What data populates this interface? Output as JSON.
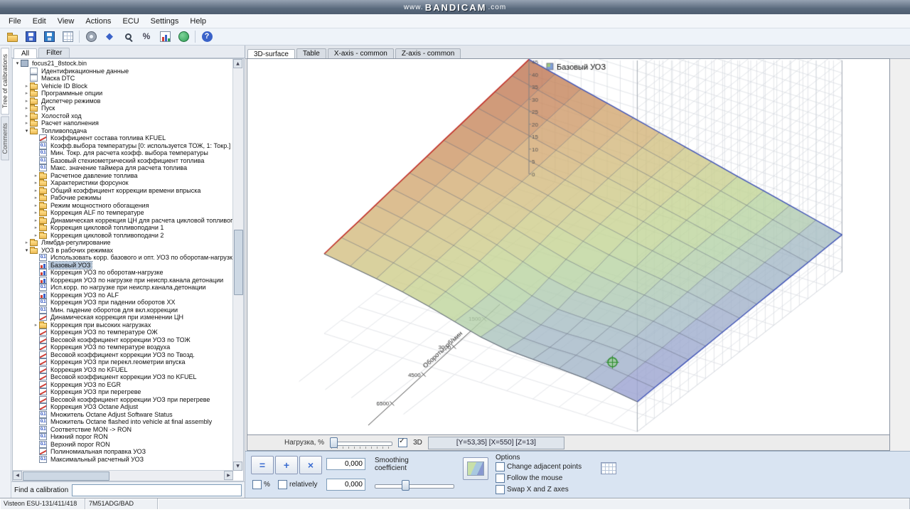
{
  "watermark": {
    "prefix": "www.",
    "brand": "BANDICAM",
    "suffix": ".com"
  },
  "menu": {
    "items": [
      "File",
      "Edit",
      "View",
      "Actions",
      "ECU",
      "Settings",
      "Help"
    ]
  },
  "toolbar": {
    "icons": [
      "open",
      "save",
      "save2",
      "table",
      "sep",
      "gear",
      "compare",
      "zoom",
      "percent",
      "chart",
      "globe",
      "sep",
      "help"
    ]
  },
  "sidebar": {
    "vertical_tabs": [
      "Tree of calibrations",
      "Comments"
    ],
    "tabs": [
      "All",
      "Filter"
    ],
    "find_label": "Find a calibration",
    "find_value": "",
    "items": [
      {
        "label": "focus21_8stock.bin",
        "indent": 0,
        "icon": "bin",
        "expand": "open"
      },
      {
        "label": "Идентификационные данные",
        "indent": 1,
        "icon": "page"
      },
      {
        "label": "Маска DTC",
        "indent": 1,
        "icon": "page"
      },
      {
        "label": "Vehicle ID Block",
        "indent": 1,
        "icon": "folder",
        "expand": "closed"
      },
      {
        "label": "Программные опции",
        "indent": 1,
        "icon": "folder",
        "expand": "closed"
      },
      {
        "label": "Диспетчер режимов",
        "indent": 1,
        "icon": "folder",
        "expand": "closed"
      },
      {
        "label": "Пуск",
        "indent": 1,
        "icon": "folder",
        "expand": "closed"
      },
      {
        "label": "Холостой ход",
        "indent": 1,
        "icon": "folder",
        "expand": "closed"
      },
      {
        "label": "Расчет наполнения",
        "indent": 1,
        "icon": "folder",
        "expand": "closed"
      },
      {
        "label": "Топливоподача",
        "indent": 1,
        "icon": "folder",
        "expand": "open"
      },
      {
        "label": "Коэффициент состава топлива KFUEL",
        "indent": 2,
        "icon": "curve"
      },
      {
        "label": "Коэфф.выбора температуры [0: используется ТОЖ, 1: Токр.]",
        "indent": 2,
        "icon": "num"
      },
      {
        "label": "Мин. Токр. для расчета коэфф. выбора температуры",
        "indent": 2,
        "icon": "num"
      },
      {
        "label": "Базовый стехиометрический коэффициент топлива",
        "indent": 2,
        "icon": "num"
      },
      {
        "label": "Макс. значение таймера для расчета топлива",
        "indent": 2,
        "icon": "num"
      },
      {
        "label": "Расчетное давление топлива",
        "indent": 2,
        "icon": "folder",
        "expand": "closed"
      },
      {
        "label": "Характеристики форсунок",
        "indent": 2,
        "icon": "folder",
        "expand": "closed"
      },
      {
        "label": "Общий коэффициент коррекции времени впрыска",
        "indent": 2,
        "icon": "folder",
        "expand": "closed"
      },
      {
        "label": "Рабочие режимы",
        "indent": 2,
        "icon": "folder",
        "expand": "closed"
      },
      {
        "label": "Режим мощностного обогащения",
        "indent": 2,
        "icon": "folder",
        "expand": "closed"
      },
      {
        "label": "Коррекция ALF по температуре",
        "indent": 2,
        "icon": "folder",
        "expand": "closed"
      },
      {
        "label": "Динамическая коррекция ЦН для расчета цикловой топливоподачи",
        "indent": 2,
        "icon": "folder",
        "expand": "closed"
      },
      {
        "label": "Коррекция цикловой топливоподачи 1",
        "indent": 2,
        "icon": "folder",
        "expand": "closed"
      },
      {
        "label": "Коррекция цикловой топливоподачи 2",
        "indent": 2,
        "icon": "folder",
        "expand": "closed"
      },
      {
        "label": "Лямбда-регулирование",
        "indent": 1,
        "icon": "folder",
        "expand": "closed"
      },
      {
        "label": "УОЗ в рабочих режимах",
        "indent": 1,
        "icon": "folder",
        "expand": "open"
      },
      {
        "label": "Использовать корр. базового и опт. УОЗ по оборотам-нагрузке",
        "indent": 2,
        "icon": "num"
      },
      {
        "label": "Базовый УОЗ",
        "indent": 2,
        "icon": "chart",
        "selected": true
      },
      {
        "label": "Коррекция УОЗ по оборотам-нагрузке",
        "indent": 2,
        "icon": "chart"
      },
      {
        "label": "Коррекция УОЗ по нагрузке при неиспр.канала детонации",
        "indent": 2,
        "icon": "chart"
      },
      {
        "label": "Исп.корр. по нагрузке при неиспр.канала.детонации",
        "indent": 2,
        "icon": "num"
      },
      {
        "label": "Коррекция УОЗ по ALF",
        "indent": 2,
        "icon": "chart"
      },
      {
        "label": "Коррекция УОЗ при падении оборотов XX",
        "indent": 2,
        "icon": "num"
      },
      {
        "label": "Мин. падение оборотов для вкл.коррекции",
        "indent": 2,
        "icon": "num"
      },
      {
        "label": "Динамическая коррекция при изменении ЦН",
        "indent": 2,
        "icon": "curve"
      },
      {
        "label": "Коррекция при высоких нагрузках",
        "indent": 2,
        "icon": "folder",
        "expand": "closed"
      },
      {
        "label": "Коррекция УОЗ по температуре ОЖ",
        "indent": 2,
        "icon": "curve"
      },
      {
        "label": "Весовой коэффициент коррекции УОЗ по ТОЖ",
        "indent": 2,
        "icon": "curve"
      },
      {
        "label": "Коррекция УОЗ по температуре воздуха",
        "indent": 2,
        "icon": "curve"
      },
      {
        "label": "Весовой коэффициент коррекции УОЗ по Твозд.",
        "indent": 2,
        "icon": "curve"
      },
      {
        "label": "Коррекция УОЗ при перекл.геометрии впуска",
        "indent": 2,
        "icon": "curve"
      },
      {
        "label": "Коррекция УОЗ по KFUEL",
        "indent": 2,
        "icon": "curve"
      },
      {
        "label": "Весовой коэффициент коррекции УОЗ по KFUEL",
        "indent": 2,
        "icon": "curve"
      },
      {
        "label": "Коррекция УОЗ по EGR",
        "indent": 2,
        "icon": "curve"
      },
      {
        "label": "Коррекция УОЗ при перегреве",
        "indent": 2,
        "icon": "curve"
      },
      {
        "label": "Весовой коэффициент коррекции УОЗ при перегреве",
        "indent": 2,
        "icon": "curve"
      },
      {
        "label": "Коррекция УОЗ Octane Adjust",
        "indent": 2,
        "icon": "curve"
      },
      {
        "label": "Множитель Octane Adjust Software Status",
        "indent": 2,
        "icon": "num"
      },
      {
        "label": "Множитель Octane flashed into vehicle at final assembly",
        "indent": 2,
        "icon": "num"
      },
      {
        "label": "Соответствие MON -> RON",
        "indent": 2,
        "icon": "num"
      },
      {
        "label": "Нижний порог RON",
        "indent": 2,
        "icon": "num"
      },
      {
        "label": "Верхний порог RON",
        "indent": 2,
        "icon": "num"
      },
      {
        "label": "Полиномиальная поправка УОЗ",
        "indent": 2,
        "icon": "curve"
      },
      {
        "label": "Максимальный расчетный УОЗ",
        "indent": 2,
        "icon": "num"
      }
    ]
  },
  "main": {
    "tabs": [
      {
        "label": "3D-surface",
        "active": true
      },
      {
        "label": "Table",
        "active": false
      },
      {
        "label": "X-axis - common",
        "active": false
      },
      {
        "label": "Z-axis - common",
        "active": false
      }
    ],
    "slider_label": "Нагрузка, %",
    "checkbox_3d": "3D",
    "readout": "[Y=53,35] [X=550] [Z=13]"
  },
  "bottom": {
    "value1": "0,000",
    "value2": "0,000",
    "pct_label": "%",
    "relatively_label": "relatively",
    "smoothing_label": "Smoothing coefficient",
    "options_title": "Options",
    "options": [
      "Change adjacent points",
      "Follow the mouse",
      "Swap X and Z axes"
    ]
  },
  "statusbar": {
    "left": "Visteon ESU-131/411/418",
    "right": "7M51ADG/BAD"
  },
  "chart_data": {
    "type": "heatmap",
    "projection": "3d-surface",
    "title": "Базовый УОЗ",
    "x_axis_label": "Обороты, об/мин",
    "x_ticks": [
      "1500",
      "3000",
      "4500",
      "6500"
    ],
    "y_axis_label": "Нагрузка, %",
    "z_ticks": [
      45,
      40,
      35,
      30,
      25,
      20,
      15,
      10,
      5,
      0
    ],
    "cursor": {
      "u": 10.2,
      "v": 1.3,
      "z": 15
    },
    "values": [
      [
        32.0,
        30.3,
        28.6,
        26.6,
        24.1,
        21.2,
        18.3,
        16.5,
        15.9,
        15.5,
        14.8,
        13.6,
        12.0
      ],
      [
        33.2,
        31.4,
        29.6,
        27.3,
        24.6,
        21.1,
        17.7,
        15.8,
        15.4,
        15.5,
        15.0,
        13.8,
        12.3
      ],
      [
        34.3,
        32.5,
        30.6,
        28.3,
        25.3,
        21.4,
        17.8,
        15.8,
        15.5,
        15.8,
        15.4,
        14.1,
        12.5
      ],
      [
        35.5,
        33.6,
        31.6,
        29.2,
        26.2,
        22.4,
        18.8,
        16.7,
        16.3,
        16.3,
        15.7,
        14.4,
        12.8
      ],
      [
        36.7,
        34.7,
        32.6,
        30.3,
        27.4,
        23.9,
        20.6,
        18.5,
        17.8,
        17.3,
        16.4,
        14.9,
        13.0
      ],
      [
        37.8,
        35.8,
        33.6,
        31.4,
        28.7,
        25.7,
        22.8,
        20.7,
        19.4,
        18.3,
        16.9,
        15.2,
        13.3
      ],
      [
        39.0,
        36.9,
        34.7,
        32.5,
        30.0,
        27.4,
        24.7,
        22.5,
        20.8,
        19.3,
        17.5,
        15.5,
        13.5
      ],
      [
        40.2,
        38.0,
        35.8,
        33.5,
        31.2,
        28.7,
        26.3,
        24.1,
        22.1,
        20.2,
        18.1,
        15.9,
        13.8
      ],
      [
        41.3,
        39.0,
        36.8,
        34.5,
        32.1,
        29.7,
        27.4,
        25.2,
        23.0,
        20.8,
        18.6,
        16.3,
        14.0
      ],
      [
        42.5,
        40.1,
        37.8,
        35.4,
        33.1,
        30.7,
        28.4,
        26.0,
        23.7,
        21.3,
        19.0,
        16.6,
        14.3
      ],
      [
        43.7,
        41.2,
        38.8,
        36.4,
        33.9,
        31.5,
        29.1,
        26.6,
        24.2,
        21.8,
        19.3,
        16.9,
        14.5
      ],
      [
        44.8,
        42.3,
        39.8,
        37.3,
        34.8,
        32.3,
        29.8,
        27.3,
        24.8,
        22.3,
        19.8,
        17.3,
        14.8
      ],
      [
        46.0,
        43.4,
        40.8,
        38.3,
        35.7,
        33.1,
        30.5,
        27.9,
        25.3,
        22.8,
        20.2,
        17.6,
        15.0
      ]
    ],
    "palette": [
      {
        "v": 12,
        "c": [
          152,
          156,
          214
        ]
      },
      {
        "v": 16,
        "c": [
          168,
          190,
          198
        ]
      },
      {
        "v": 20,
        "c": [
          182,
          211,
          168
        ]
      },
      {
        "v": 24,
        "c": [
          196,
          214,
          152
        ]
      },
      {
        "v": 28,
        "c": [
          207,
          206,
          142
        ]
      },
      {
        "v": 32,
        "c": [
          212,
          192,
          132
        ]
      },
      {
        "v": 36,
        "c": [
          212,
          172,
          118
        ]
      },
      {
        "v": 40,
        "c": [
          202,
          142,
          98
        ]
      },
      {
        "v": 46,
        "c": [
          188,
          112,
          82
        ]
      }
    ]
  }
}
